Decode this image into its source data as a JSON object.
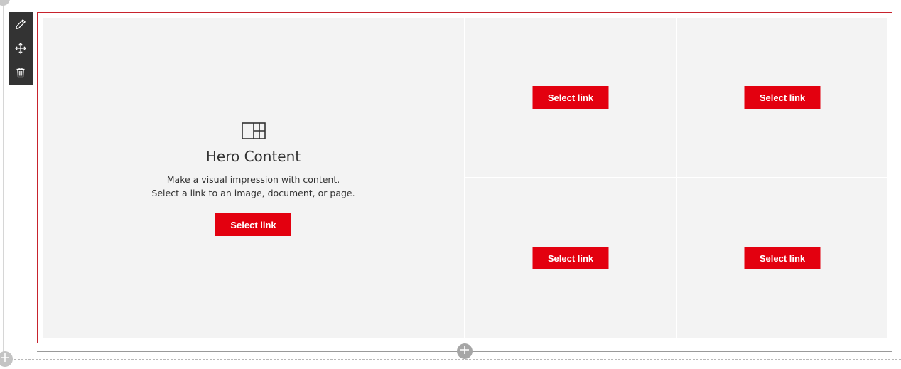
{
  "toolbar": {
    "icons": [
      "edit-icon",
      "move-icon",
      "delete-icon"
    ]
  },
  "hero": {
    "icon": "hero-layout-icon",
    "title": "Hero Content",
    "description_line1": "Make a visual impression with content.",
    "description_line2": "Select a link to an image, document, or page.",
    "button_label": "Select link"
  },
  "tiles": [
    {
      "button_label": "Select link"
    },
    {
      "button_label": "Select link"
    },
    {
      "button_label": "Select link"
    },
    {
      "button_label": "Select link"
    }
  ],
  "colors": {
    "accent": "#e3000f",
    "frame": "#c7232d",
    "tile_bg": "#f3f3f3",
    "toolbar_bg": "#333333"
  },
  "add_section_icons": [
    "add-section-icon",
    "add-section-icon"
  ]
}
